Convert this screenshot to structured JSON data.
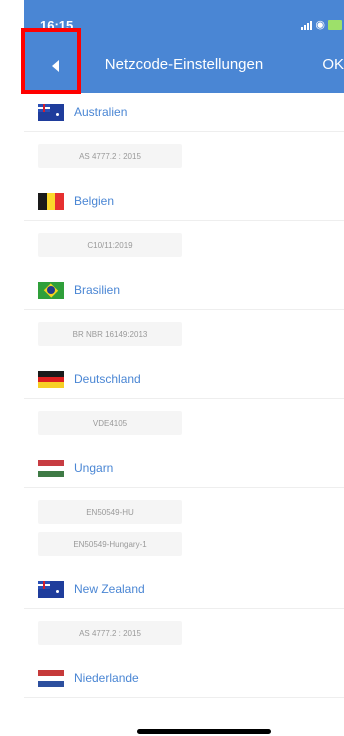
{
  "status": {
    "time": "16:15"
  },
  "nav": {
    "title": "Netzcode-Einstellungen",
    "ok_label": "OK"
  },
  "countries": [
    {
      "name": "Australien",
      "flag": "australia-flag",
      "codes": [
        "AS 4777.2 : 2015"
      ]
    },
    {
      "name": "Belgien",
      "flag": "belgium-flag",
      "codes": [
        "C10/11:2019"
      ]
    },
    {
      "name": "Brasilien",
      "flag": "brazil-flag",
      "codes": [
        "BR NBR 16149:2013"
      ]
    },
    {
      "name": "Deutschland",
      "flag": "germany-flag",
      "codes": [
        "VDE4105"
      ]
    },
    {
      "name": "Ungarn",
      "flag": "hungary-flag",
      "codes": [
        "EN50549-HU",
        "EN50549-Hungary-1"
      ]
    },
    {
      "name": "New Zealand",
      "flag": "new-zealand-flag",
      "codes": [
        "AS 4777.2 : 2015"
      ]
    },
    {
      "name": "Niederlande",
      "flag": "netherlands-flag",
      "codes": []
    }
  ],
  "colors": {
    "header": "#4a86d4",
    "link": "#4a86d4",
    "highlight": "#ff0000"
  }
}
